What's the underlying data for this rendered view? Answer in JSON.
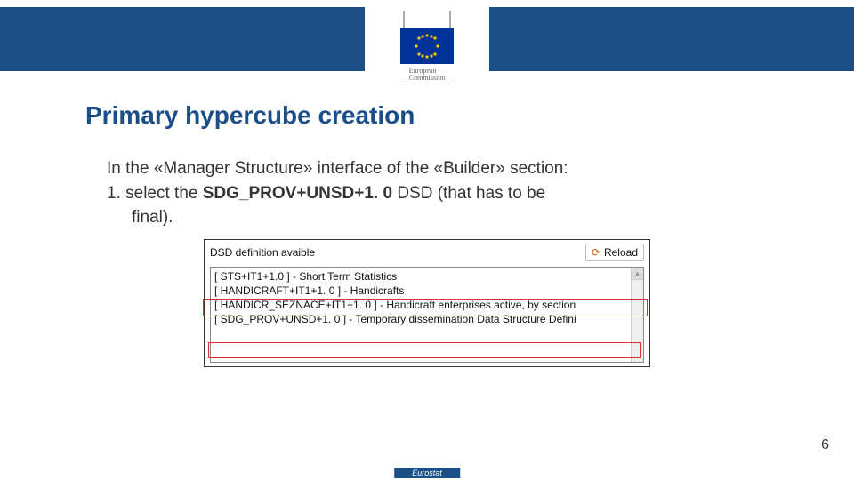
{
  "header": {
    "logo_text": "European\nCommission"
  },
  "title": "Primary hypercube creation",
  "body": {
    "intro_a": "In the «Manager Structure» interface of the «Builder» section:",
    "step_prefix": "1. select the ",
    "step_bold": "SDG_PROV+UNSD+1. 0",
    "step_suffix_a": " DSD (that has to be",
    "step_suffix_b": "final)."
  },
  "panel": {
    "label": "DSD definition avaible",
    "reload": "Reload",
    "items": [
      "[ STS+IT1+1.0 ] - Short Term Statistics",
      "[ HANDICRAFT+IT1+1. 0 ] - Handicrafts",
      "[ HANDICR_SEZNACE+IT1+1. 0 ] - Handicraft enterprises active, by section",
      "[ SDG_PROV+UNSD+1. 0 ] - Temporary dissemination Data Structure Defini"
    ]
  },
  "page_number": "6",
  "footer": "Eurostat"
}
